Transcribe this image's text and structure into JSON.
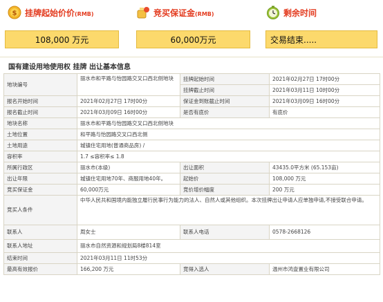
{
  "stats": {
    "start_price_label": "挂牌起始价价",
    "start_price_unit": "(RMB)",
    "start_price_value": "108,000 万元",
    "deposit_label": "竞买保证金",
    "deposit_unit": "(RMB)",
    "deposit_value": "60,000万元",
    "remaining_label": "剩余时间",
    "remaining_value": "交易结束....."
  },
  "section_title": "国有建设用地使用权 挂牌 出让基本信息",
  "rows": {
    "parcel_no_label": "地块编号",
    "parcel_no_value": "丽水市和平路与怡园路交叉口西北侧地块",
    "listing_start_label": "挂牌起始时间",
    "listing_start_value": "2021年02月27日 17时00分",
    "listing_end_label": "挂牌截止时间",
    "listing_end_value": "2021年03月11日 10时00分",
    "reg_start_label": "报名开始时间",
    "reg_start_value": "2021年02月27日 17时00分",
    "deposit_deadline_label": "保证金到账截止时间",
    "deposit_deadline_value": "2021年03月09日 16时00分",
    "reg_end_label": "报名截止时间",
    "reg_end_value": "2021年03月09日 16时00分",
    "reserve_label": "是否有底价",
    "reserve_value": "有底价",
    "parcel_name_label": "地块名称",
    "parcel_name_value": "丽水市和平路与怡园路交叉口西北侧地块",
    "location_label": "土地位置",
    "location_value": "和平路与怡园路交叉口西北侧",
    "usage_label": "土地用途",
    "usage_value": "城镇住宅用地(普通商品房) /",
    "far_label": "容积率",
    "far_value": "1.7 ≤容积率≤ 1.8",
    "district_label": "所属行政区",
    "district_value": "丽水市(本级)",
    "area_label": "出让面积",
    "area_value": "43435.0平方米 (65.153亩)",
    "term_label": "出让年限",
    "term_value": "城镇住宅用地70年、商服用地40年。",
    "start_price_label": "起始价",
    "start_price_value": "108,000 万元",
    "bid_deposit_label": "竞买保证金",
    "bid_deposit_value": "60,000万元",
    "increment_label": "竞价增价幅度",
    "increment_value": "200 万元",
    "conditions_label": "竞买人条件",
    "conditions_value": "中华人民共和国境内能独立履行民事行为能力的法人、自然人或其他组织。本次挂牌出让申请人应单独申请,不接受联合申请。",
    "contact_label": "联系人",
    "contact_value": "周女士",
    "phone_label": "联系人电话",
    "phone_value": "0578-2668126",
    "address_label": "联系人地址",
    "address_value": "丽水市自然资源和规划局8楼814室",
    "end_time_label": "结束时间",
    "end_time_value": "2021年03月11日 11时53分",
    "top_bid_label": "最高有效报价",
    "top_bid_value": "166,200 万元",
    "bidder_label": "竞得入选人",
    "bidder_value": "温州市鸿壹置业有限公司"
  }
}
